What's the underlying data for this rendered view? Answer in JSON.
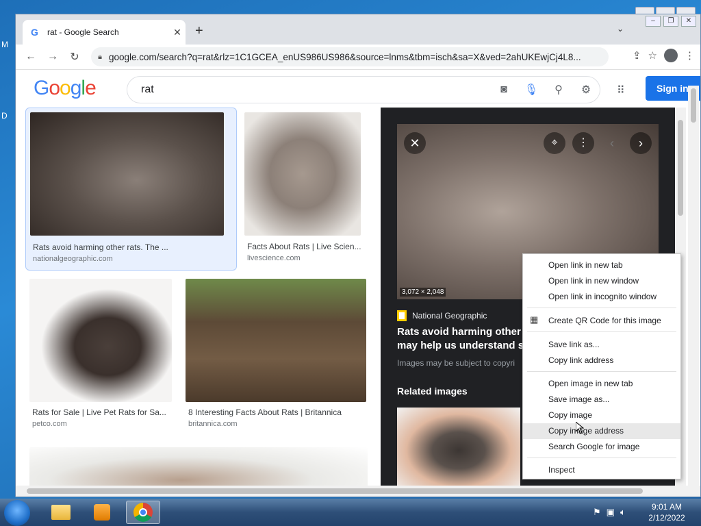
{
  "desktop": {
    "frag1": "M",
    "frag2": "D"
  },
  "browser": {
    "tab_title": "rat - Google Search",
    "tab_favicon": "G",
    "new_tab": "+",
    "url": "google.com/search?q=rat&rlz=1C1GCEA_enUS986US986&source=lnms&tbm=isch&sa=X&ved=2ahUKEwjCj4L8..."
  },
  "google": {
    "logo": [
      "G",
      "o",
      "o",
      "g",
      "l",
      "e"
    ],
    "query": "rat",
    "signin": "Sign in"
  },
  "results": [
    {
      "caption": "Rats avoid harming other rats. The ...",
      "source": "nationalgeographic.com"
    },
    {
      "caption": "Facts About Rats | Live Scien...",
      "source": "livescience.com"
    },
    {
      "caption": "Rats for Sale | Live Pet Rats for Sa...",
      "source": "petco.com"
    },
    {
      "caption": "8 Interesting Facts About Rats | Britannica",
      "source": "britannica.com"
    }
  ],
  "preview": {
    "dimensions": "3,072 × 2,048",
    "source": "National Geographic",
    "title": "Rats avoid harming other ra... may help us understand soc...",
    "title_line1": "Rats avoid harming other ra",
    "title_line2": "may help us understand soc",
    "note": "Images may be subject to copyri",
    "related": "Related images"
  },
  "context_menu": {
    "items": [
      "Open link in new tab",
      "Open link in new window",
      "Open link in incognito window",
      "Create QR Code for this image",
      "Save link as...",
      "Copy link address",
      "Open image in new tab",
      "Save image as...",
      "Copy image",
      "Copy image address",
      "Search Google for image",
      "Inspect"
    ],
    "highlighted_index": 9
  },
  "taskbar": {
    "time": "9:01 AM",
    "date": "2/12/2022"
  },
  "colors": {
    "accent": "#1a73e8",
    "preview_bg": "#202124",
    "selected_card": "#e8f0fe"
  }
}
